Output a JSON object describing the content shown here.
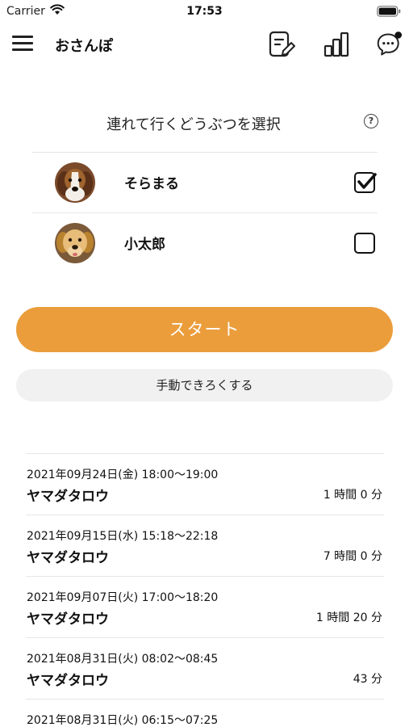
{
  "status_bar": {
    "carrier": "Carrier",
    "time": "17:53"
  },
  "nav": {
    "title": "おさんぽ",
    "icons": [
      "menu-icon",
      "edit-icon",
      "stats-icon",
      "chat-icon"
    ],
    "notification_dot": true
  },
  "select": {
    "title": "連れて行くどうぶつを選択",
    "help": "?"
  },
  "animals": [
    {
      "name": "そらまる",
      "checked": true
    },
    {
      "name": "小太郎",
      "checked": false
    }
  ],
  "buttons": {
    "start": "スタート",
    "manual": "手動できろくする"
  },
  "history": [
    {
      "date": "2021年09月24日(金) 18:00〜19:00",
      "user": "ヤマダタロウ",
      "duration": "1 時間 0 分"
    },
    {
      "date": "2021年09月15日(水) 15:18〜22:18",
      "user": "ヤマダタロウ",
      "duration": "7 時間 0 分"
    },
    {
      "date": "2021年09月07日(火) 17:00〜18:20",
      "user": "ヤマダタロウ",
      "duration": "1 時間 20 分"
    },
    {
      "date": "2021年08月31日(火) 08:02〜08:45",
      "user": "ヤマダタロウ",
      "duration": "43 分"
    },
    {
      "date": "2021年08月31日(火) 06:15〜07:25",
      "user": "",
      "duration": ""
    }
  ],
  "colors": {
    "accent": "#eb9d3c",
    "secondary_button": "#f1f1f1",
    "divider": "#e6e6e6"
  }
}
